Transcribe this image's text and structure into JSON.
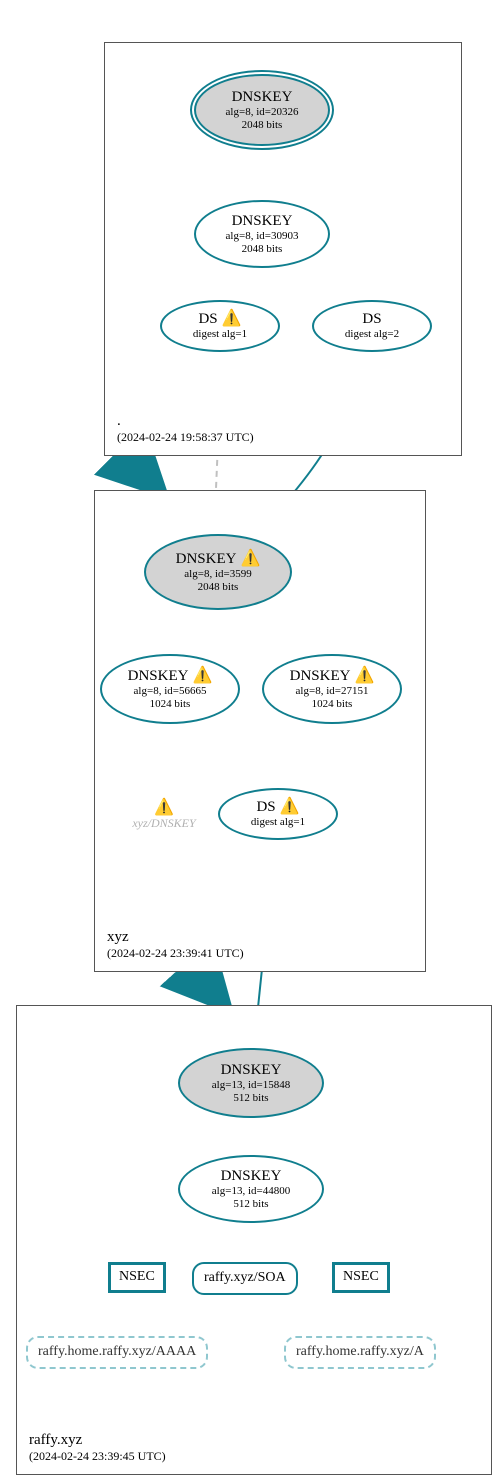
{
  "zones": {
    "root": {
      "name": ".",
      "timestamp": "(2024-02-24 19:58:37 UTC)"
    },
    "xyz": {
      "name": "xyz",
      "timestamp": "(2024-02-24 23:39:41 UTC)"
    },
    "raffy": {
      "name": "raffy.xyz",
      "timestamp": "(2024-02-24 23:39:45 UTC)"
    }
  },
  "nodes": {
    "root_ksk": {
      "title": "DNSKEY",
      "line1": "alg=8, id=20326",
      "line2": "2048 bits"
    },
    "root_zsk": {
      "title": "DNSKEY",
      "line1": "alg=8, id=30903",
      "line2": "2048 bits"
    },
    "root_ds1": {
      "title": "DS",
      "warn": "⚠️",
      "line1": "digest alg=1"
    },
    "root_ds2": {
      "title": "DS",
      "line1": "digest alg=2"
    },
    "xyz_ksk": {
      "title": "DNSKEY",
      "warn": "⚠️",
      "line1": "alg=8, id=3599",
      "line2": "2048 bits"
    },
    "xyz_zsk1": {
      "title": "DNSKEY",
      "warn": "⚠️",
      "line1": "alg=8, id=56665",
      "line2": "1024 bits"
    },
    "xyz_zsk2": {
      "title": "DNSKEY",
      "warn": "⚠️",
      "line1": "alg=8, id=27151",
      "line2": "1024 bits"
    },
    "xyz_ds": {
      "title": "DS",
      "warn": "⚠️",
      "line1": "digest alg=1"
    },
    "xyz_float": {
      "warn": "⚠️",
      "label": "xyz/DNSKEY"
    },
    "raffy_ksk": {
      "title": "DNSKEY",
      "line1": "alg=13, id=15848",
      "line2": "512 bits"
    },
    "raffy_zsk": {
      "title": "DNSKEY",
      "line1": "alg=13, id=44800",
      "line2": "512 bits"
    },
    "nsec1": {
      "title": "NSEC"
    },
    "soa": {
      "title": "raffy.xyz/SOA"
    },
    "nsec2": {
      "title": "NSEC"
    },
    "rr_aaaa": {
      "title": "raffy.home.raffy.xyz/AAAA"
    },
    "rr_a": {
      "title": "raffy.home.raffy.xyz/A"
    }
  },
  "colors": {
    "edge": "#107e8e",
    "edge_dashed": "#c0c0c0"
  }
}
